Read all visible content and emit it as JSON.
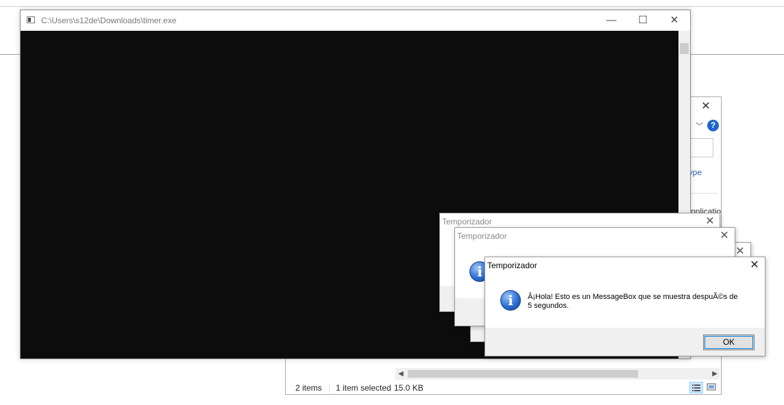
{
  "console": {
    "title": "C:\\Users\\s12de\\Downloads\\timer.exe",
    "minimize_icon": "minimize-icon",
    "maximize_icon": "maximize-icon",
    "close_icon": "close-icon",
    "background": "#0c0c0c"
  },
  "explorer": {
    "partial_type_label": "ype",
    "partial_app_label": "pplicatio",
    "status": {
      "items": "2 items",
      "selected": "1 item selected",
      "size": "15.0 KB"
    }
  },
  "messagebox": {
    "title": "Temporizador",
    "message_line1": "Â¡Hola! Esto es un MessageBox que se muestra despuÃ©s de",
    "message_line2": "5 segundos.",
    "ok_label": "OK",
    "icon": "info-icon"
  },
  "colors": {
    "accent": "#0078d7",
    "help_icon": "#1e67c9",
    "link": "#2a5ea8"
  }
}
